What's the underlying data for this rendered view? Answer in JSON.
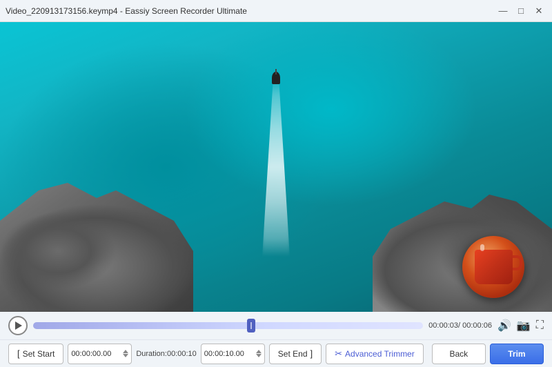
{
  "titlebar": {
    "text": "Video_220913173156.keymp4  -  Eassiy Screen Recorder Ultimate",
    "minimize": "—",
    "maximize": "□",
    "close": "✕"
  },
  "timeline": {
    "current_time": "00:00:03",
    "total_time": "00:00:06",
    "progress_percent": 56
  },
  "controls": {
    "set_start_label": "Set Start",
    "start_time_value": "00:00:00.00",
    "duration_label": "Duration:00:00:10",
    "end_time_value": "00:00:10.00",
    "set_end_label": "Set End",
    "advanced_label": "Advanced Trimmer",
    "back_label": "Back",
    "trim_label": "Trim",
    "time_separator": "/",
    "volume_icon": "🔊",
    "camera_icon": "📷",
    "fullscreen_icon": "⛶"
  }
}
